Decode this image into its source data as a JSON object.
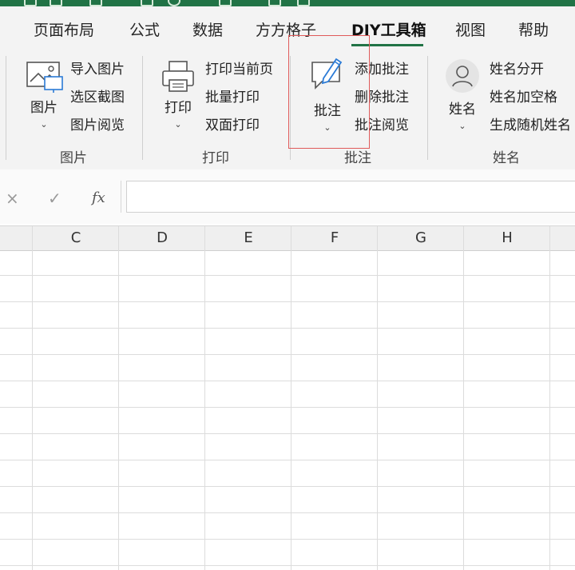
{
  "ribbon_tabs": [
    {
      "label": "页面布局"
    },
    {
      "label": "公式"
    },
    {
      "label": "数据"
    },
    {
      "label": "方方格子"
    },
    {
      "label": "DIY工具箱"
    },
    {
      "label": "视图"
    },
    {
      "label": "帮助"
    }
  ],
  "active_tab": "DIY工具箱",
  "groups": {
    "picture": {
      "title": "图片",
      "big_button": "图片",
      "items": [
        "导入图片",
        "选区截图",
        "图片阅览"
      ]
    },
    "print": {
      "title": "打印",
      "big_button": "打印",
      "items": [
        "打印当前页",
        "批量打印",
        "双面打印"
      ]
    },
    "comment": {
      "title": "批注",
      "big_button": "批注",
      "items": [
        "添加批注",
        "删除批注",
        "批注阅览"
      ]
    },
    "name": {
      "title": "姓名",
      "big_button": "姓名",
      "items": [
        "姓名分开",
        "姓名加空格",
        "生成随机姓名"
      ]
    }
  },
  "formula_bar": {
    "cancel_icon": "×",
    "confirm_icon": "✓",
    "fx_label": "fx",
    "value": ""
  },
  "columns": [
    "C",
    "D",
    "E",
    "F",
    "G",
    "H"
  ],
  "colors": {
    "accent": "#217346",
    "highlight_box": "#e05a5a"
  }
}
